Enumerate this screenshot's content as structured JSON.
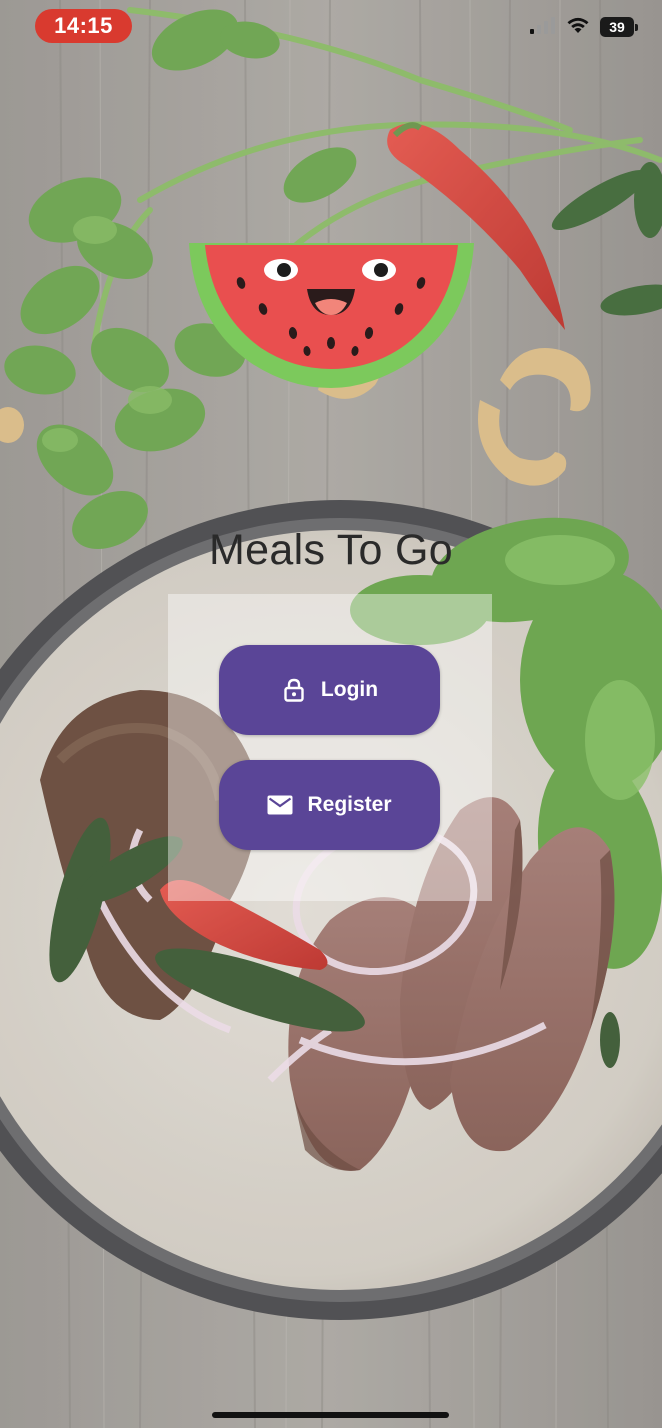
{
  "status_bar": {
    "time": "14:15",
    "battery_level": "39",
    "icons": [
      "cellular-signal-icon",
      "wifi-icon",
      "battery-icon"
    ]
  },
  "app": {
    "title": "Meals To Go",
    "logo": "watermelon-face-logo"
  },
  "buttons": {
    "login": {
      "label": "Login",
      "icon": "lock-icon"
    },
    "register": {
      "label": "Register",
      "icon": "envelope-icon"
    }
  },
  "colors": {
    "button_background": "#5a4597",
    "button_text": "#ffffff",
    "time_pill": "#d93a2f",
    "panel": "rgba(255,255,255,0.42)"
  }
}
